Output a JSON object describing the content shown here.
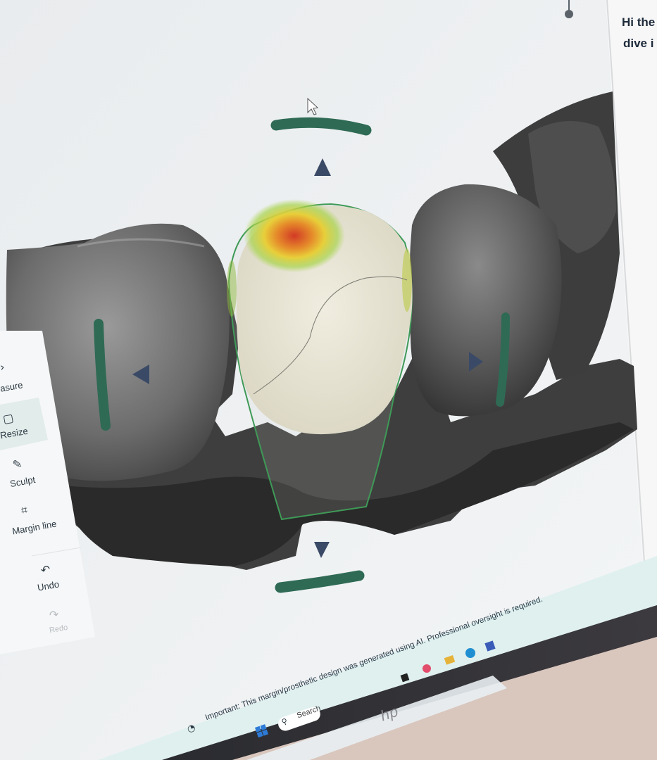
{
  "toolbar": {
    "measure_label": "asure",
    "resize_label": "Resize",
    "sculpt_label": "Sculpt",
    "margin_line_label": "Margin line",
    "undo_label": "Undo",
    "redo_label": "Redo"
  },
  "chat_panel": {
    "line1": "Hi the",
    "line2": "dive i"
  },
  "notice": {
    "text": "Important: This margin/prosthetic design was generated using AI. Professional oversight is required."
  },
  "taskbar": {
    "search_label": "Search",
    "laptop_logo": "hp"
  },
  "colors": {
    "handle_green": "#2f6a55",
    "arrow_navy": "#3a4a66",
    "selection_outline": "#3f9a57",
    "crown_base": "#e6e2cf",
    "heatmap_hot": "#d9472b",
    "heatmap_warm": "#e9b92b",
    "screen_bg": "#eef1f2"
  }
}
